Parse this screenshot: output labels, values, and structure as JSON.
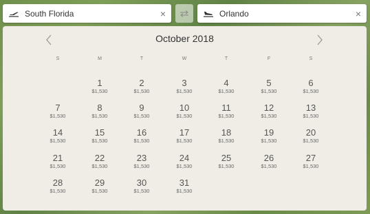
{
  "origin": {
    "value": "South Florida",
    "clear_glyph": "×",
    "icon": "plane-takeoff-icon"
  },
  "destination": {
    "value": "Orlando",
    "clear_glyph": "×",
    "icon": "plane-landing-icon"
  },
  "swap": {
    "icon": "swap-arrows-icon"
  },
  "calendar": {
    "month_title": "October 2018",
    "prev_icon": "chevron-left-icon",
    "next_icon": "chevron-right-icon",
    "weekdays": [
      "S",
      "M",
      "T",
      "W",
      "T",
      "F",
      "S"
    ],
    "first_weekday_index": 1,
    "days": [
      {
        "day": "1",
        "price": "$1,530"
      },
      {
        "day": "2",
        "price": "$1,530"
      },
      {
        "day": "3",
        "price": "$1,530"
      },
      {
        "day": "4",
        "price": "$1,530"
      },
      {
        "day": "5",
        "price": "$1,530"
      },
      {
        "day": "6",
        "price": "$1,530"
      },
      {
        "day": "7",
        "price": "$1,530"
      },
      {
        "day": "8",
        "price": "$1,530"
      },
      {
        "day": "9",
        "price": "$1,530"
      },
      {
        "day": "10",
        "price": "$1,530"
      },
      {
        "day": "11",
        "price": "$1,530"
      },
      {
        "day": "12",
        "price": "$1,530"
      },
      {
        "day": "13",
        "price": "$1,530"
      },
      {
        "day": "14",
        "price": "$1,530"
      },
      {
        "day": "15",
        "price": "$1,530"
      },
      {
        "day": "16",
        "price": "$1,530"
      },
      {
        "day": "17",
        "price": "$1,530"
      },
      {
        "day": "18",
        "price": "$1,530"
      },
      {
        "day": "19",
        "price": "$1,530"
      },
      {
        "day": "20",
        "price": "$1,530"
      },
      {
        "day": "21",
        "price": "$1,530"
      },
      {
        "day": "22",
        "price": "$1,530"
      },
      {
        "day": "23",
        "price": "$1,530"
      },
      {
        "day": "24",
        "price": "$1,530"
      },
      {
        "day": "25",
        "price": "$1,530"
      },
      {
        "day": "26",
        "price": "$1,530"
      },
      {
        "day": "27",
        "price": "$1,530"
      },
      {
        "day": "28",
        "price": "$1,530"
      },
      {
        "day": "29",
        "price": "$1,530"
      },
      {
        "day": "30",
        "price": "$1,530"
      },
      {
        "day": "31",
        "price": "$1,530"
      }
    ]
  }
}
